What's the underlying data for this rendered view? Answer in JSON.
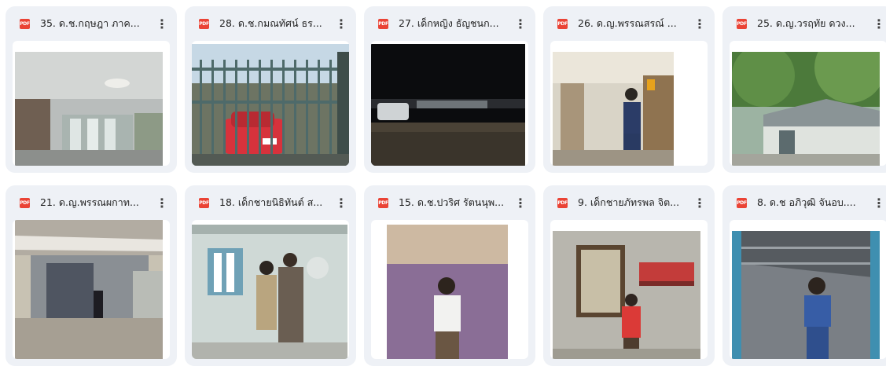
{
  "files": [
    {
      "title": "35. ด.ช.กฤษฎา ภาค...",
      "file_type": "PDF",
      "menu_icon": "more-vert-icon"
    },
    {
      "title": "28. ด.ช.กมณทัศน์ ธร...",
      "file_type": "PDF",
      "menu_icon": "more-vert-icon"
    },
    {
      "title": "27. เด็กหญิง ธัญชนก...",
      "file_type": "PDF",
      "menu_icon": "more-vert-icon"
    },
    {
      "title": "26. ด.ญ.พรรณสรณ์ ...",
      "file_type": "PDF",
      "menu_icon": "more-vert-icon"
    },
    {
      "title": "25. ด.ญ.วรฤทัย ดวง...",
      "file_type": "PDF",
      "menu_icon": "more-vert-icon"
    },
    {
      "title": "21. ด.ญ.พรรณผกาท...",
      "file_type": "PDF",
      "menu_icon": "more-vert-icon"
    },
    {
      "title": "18. เด็กชายนิธิทันต์ ส...",
      "file_type": "PDF",
      "menu_icon": "more-vert-icon"
    },
    {
      "title": "15. ด.ช.ปวริศ รัตนนุพ...",
      "file_type": "PDF",
      "menu_icon": "more-vert-icon"
    },
    {
      "title": "9. เด็กชายภัทรพล จิต...",
      "file_type": "PDF",
      "menu_icon": "more-vert-icon"
    },
    {
      "title": "8. ด.ช อภิวุฒิ จันอบ....",
      "file_type": "PDF",
      "menu_icon": "more-vert-icon"
    }
  ],
  "colors": {
    "card_bg": "#eef1f6",
    "pdf_red": "#ea4335",
    "text": "#1f1f1f"
  }
}
